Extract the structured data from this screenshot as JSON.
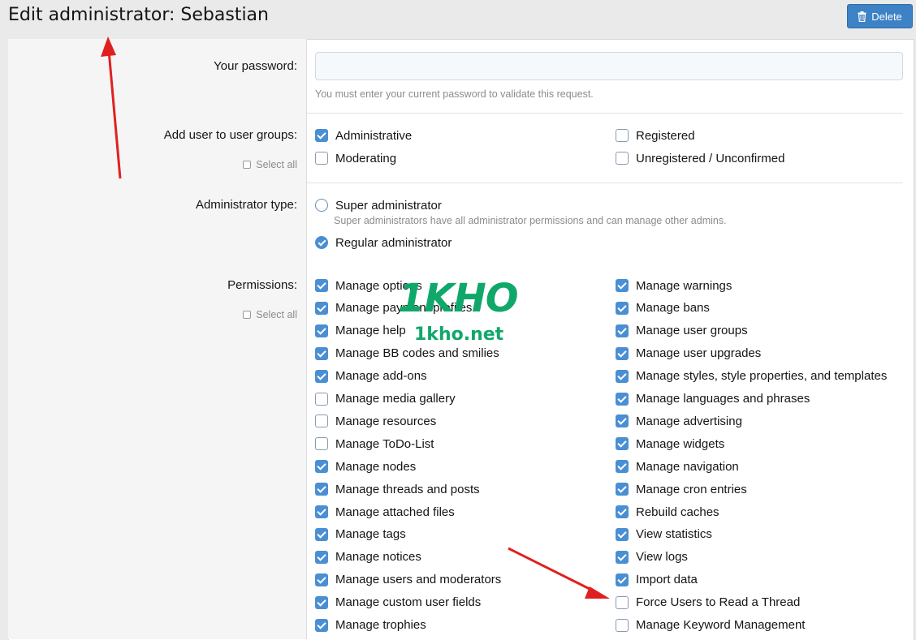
{
  "page": {
    "title": "Edit administrator: Sebastian"
  },
  "toolbar": {
    "delete_label": "Delete",
    "delete_icon": "trash-icon"
  },
  "password": {
    "label": "Your password:",
    "value": "",
    "placeholder": "",
    "hint": "You must enter your current password to validate this request."
  },
  "user_groups": {
    "label": "Add user to user groups:",
    "select_all": "Select all",
    "options": [
      {
        "label": "Administrative",
        "checked": true
      },
      {
        "label": "Moderating",
        "checked": false
      },
      {
        "label": "Registered",
        "checked": false
      },
      {
        "label": "Unregistered / Unconfirmed",
        "checked": false
      }
    ]
  },
  "admin_type": {
    "label": "Administrator type:",
    "options": [
      {
        "label": "Super administrator",
        "hint": "Super administrators have all administrator permissions and can manage other admins.",
        "checked": false
      },
      {
        "label": "Regular administrator",
        "checked": true
      }
    ]
  },
  "permissions": {
    "label": "Permissions:",
    "select_all": "Select all",
    "left": [
      {
        "label": "Manage options",
        "checked": true
      },
      {
        "label": "Manage payment profiles",
        "checked": true
      },
      {
        "label": "Manage help",
        "checked": true
      },
      {
        "label": "Manage BB codes and smilies",
        "checked": true
      },
      {
        "label": "Manage add-ons",
        "checked": true
      },
      {
        "label": "Manage media gallery",
        "checked": false
      },
      {
        "label": "Manage resources",
        "checked": false
      },
      {
        "label": "Manage ToDo-List",
        "checked": false
      },
      {
        "label": "Manage nodes",
        "checked": true
      },
      {
        "label": "Manage threads and posts",
        "checked": true
      },
      {
        "label": "Manage attached files",
        "checked": true
      },
      {
        "label": "Manage tags",
        "checked": true
      },
      {
        "label": "Manage notices",
        "checked": true
      },
      {
        "label": "Manage users and moderators",
        "checked": true
      },
      {
        "label": "Manage custom user fields",
        "checked": true
      },
      {
        "label": "Manage trophies",
        "checked": true
      }
    ],
    "right": [
      {
        "label": "Manage warnings",
        "checked": true
      },
      {
        "label": "Manage bans",
        "checked": true
      },
      {
        "label": "Manage user groups",
        "checked": true
      },
      {
        "label": "Manage user upgrades",
        "checked": true
      },
      {
        "label": "Manage styles, style properties, and templates",
        "checked": true
      },
      {
        "label": "Manage languages and phrases",
        "checked": true
      },
      {
        "label": "Manage advertising",
        "checked": true
      },
      {
        "label": "Manage widgets",
        "checked": true
      },
      {
        "label": "Manage navigation",
        "checked": true
      },
      {
        "label": "Manage cron entries",
        "checked": true
      },
      {
        "label": "Rebuild caches",
        "checked": true
      },
      {
        "label": "View statistics",
        "checked": true
      },
      {
        "label": "View logs",
        "checked": true
      },
      {
        "label": "Import data",
        "checked": true
      },
      {
        "label": "Force Users to Read a Thread",
        "checked": false
      },
      {
        "label": "Manage Keyword Management",
        "checked": false
      }
    ]
  },
  "watermark": {
    "brand": "1KHO",
    "site": "1kho.net"
  },
  "colors": {
    "accent": "#4a8fd3",
    "button": "#3c82c4",
    "annotation_arrow": "#e02020",
    "watermark": "#10a86a"
  }
}
